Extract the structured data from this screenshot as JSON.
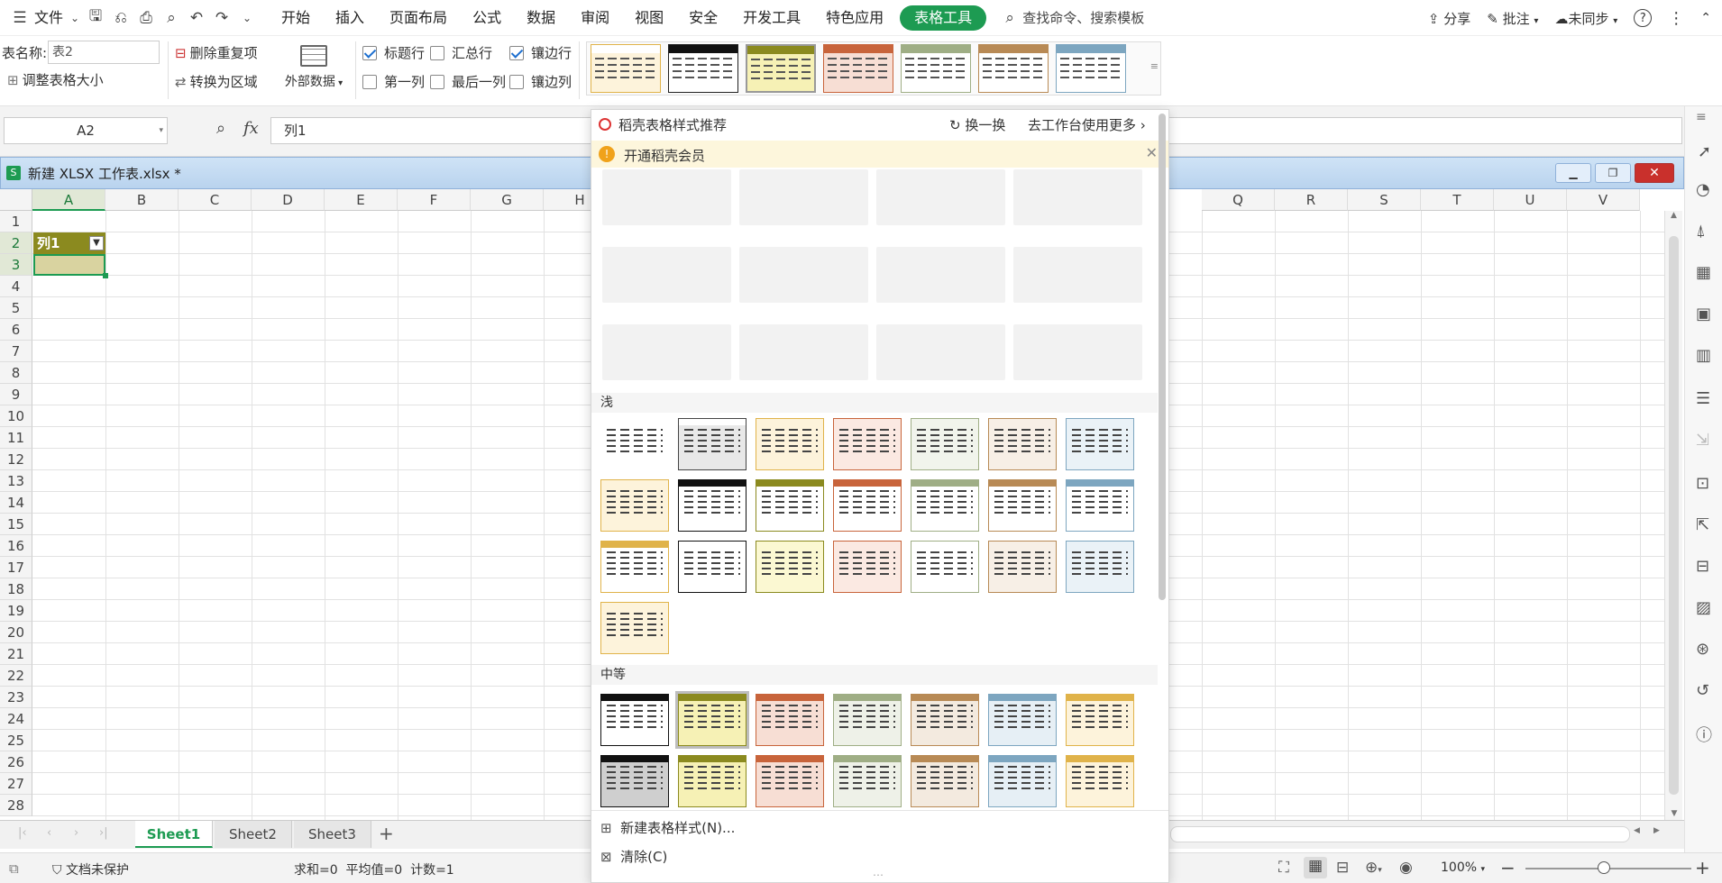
{
  "menubar": {
    "file": "文件",
    "tabs": [
      "开始",
      "插入",
      "页面布局",
      "公式",
      "数据",
      "审阅",
      "视图",
      "安全",
      "开发工具",
      "特色应用",
      "表格工具"
    ],
    "search_placeholder": "查找命令、搜索模板",
    "share": "分享",
    "comment": "批注",
    "sync": "未同步"
  },
  "ribbon": {
    "table_name_label": "表名称:",
    "table_name_value": "表2",
    "resize_table": "调整表格大小",
    "remove_duplicates": "删除重复项",
    "convert_to_range": "转换为区域",
    "external_data": "外部数据",
    "options": [
      {
        "label": "标题行",
        "checked": true
      },
      {
        "label": "汇总行",
        "checked": false
      },
      {
        "label": "镶边行",
        "checked": true
      },
      {
        "label": "第一列",
        "checked": false
      },
      {
        "label": "最后一列",
        "checked": false
      },
      {
        "label": "镶边列",
        "checked": false
      }
    ]
  },
  "formula_bar": {
    "cell_ref": "A2",
    "fx": "fx",
    "value": "列1"
  },
  "workbook": {
    "title": "新建 XLSX 工作表.xlsx *",
    "columns": [
      "A",
      "B",
      "C",
      "D",
      "E",
      "F",
      "G",
      "H",
      "Q",
      "R",
      "S",
      "T",
      "U",
      "V"
    ],
    "rows": [
      "1",
      "2",
      "3",
      "4",
      "5",
      "6",
      "7",
      "8",
      "9",
      "10",
      "11",
      "12",
      "13",
      "14",
      "15",
      "16",
      "17",
      "18",
      "19",
      "20",
      "21",
      "22",
      "23",
      "24",
      "25",
      "26",
      "27",
      "28"
    ],
    "header_cell": "列1",
    "sheets": [
      "Sheet1",
      "Sheet2",
      "Sheet3"
    ],
    "add_sheet": "+"
  },
  "status": {
    "protect": "文档未保护",
    "summary": "求和=0  平均值=0  计数=1",
    "zoom": "100%"
  },
  "panel": {
    "title": "稻壳表格样式推荐",
    "refresh": "换一换",
    "more": "去工作台使用更多",
    "vip_banner": "开通稻壳会员",
    "section_light": "浅",
    "section_medium": "中等",
    "new_style": "新建表格样式(N)...",
    "clear": "清除(C)"
  },
  "colors": {
    "accent_green": "#1d9b52",
    "olive": "#8b8a1f",
    "orange_red": "#c8643b",
    "sage": "#9fae85",
    "tan": "#b88a55",
    "steel_blue": "#7da6c0",
    "gold": "#e0b34a"
  }
}
